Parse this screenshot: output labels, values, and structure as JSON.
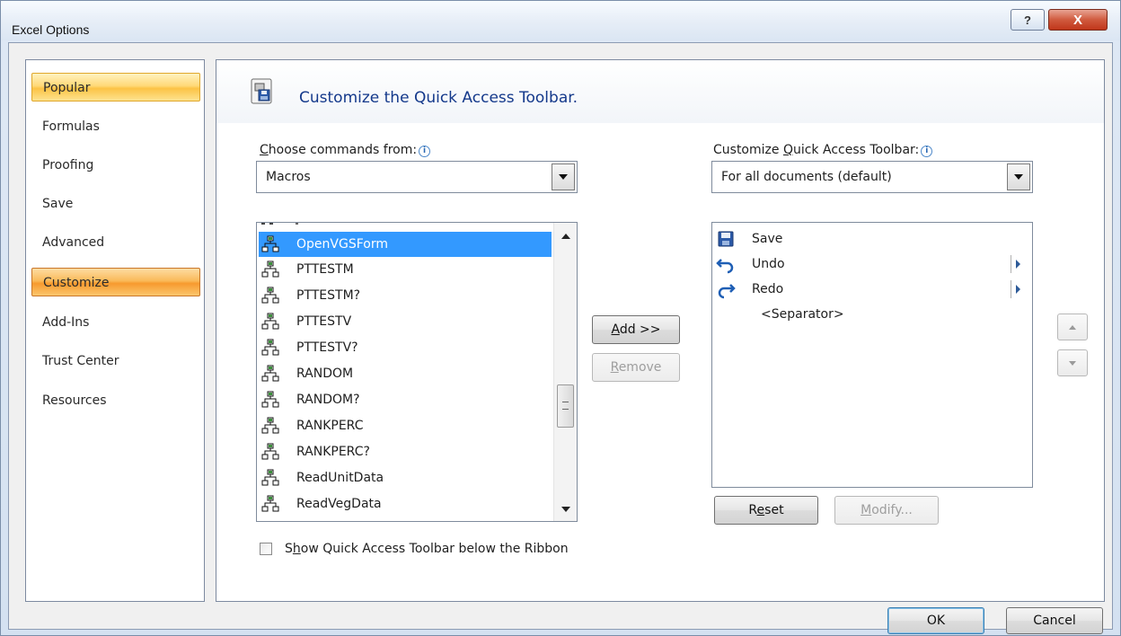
{
  "window": {
    "title": "Excel Options",
    "help_glyph": "?",
    "close_glyph": "X"
  },
  "nav": {
    "items": [
      {
        "label": "Popular",
        "state": "selected"
      },
      {
        "label": "Formulas"
      },
      {
        "label": "Proofing"
      },
      {
        "label": "Save"
      },
      {
        "label": "Advanced"
      },
      {
        "label": "Customize",
        "state": "active"
      },
      {
        "label": "Add-Ins"
      },
      {
        "label": "Trust Center"
      },
      {
        "label": "Resources"
      }
    ]
  },
  "header": {
    "title": "Customize the Quick Access Toolbar.",
    "icon": "customize-toolbar-icon"
  },
  "choose": {
    "label_pre": "",
    "label_key": "C",
    "label_post": "hoose commands from:",
    "value": "Macros"
  },
  "commands": {
    "items": [
      {
        "label": "OpenVGSForm",
        "selected": true
      },
      {
        "label": "PTTESTM"
      },
      {
        "label": "PTTESTM?"
      },
      {
        "label": "PTTESTV"
      },
      {
        "label": "PTTESTV?"
      },
      {
        "label": "RANDOM"
      },
      {
        "label": "RANDOM?"
      },
      {
        "label": "RANKPERC"
      },
      {
        "label": "RANKPERC?"
      },
      {
        "label": "ReadUnitData"
      },
      {
        "label": "ReadVegData"
      }
    ],
    "icon": "macro-icon"
  },
  "actions": {
    "add_key": "A",
    "add_rest": "dd >>",
    "remove_key": "R",
    "remove_rest": "emove"
  },
  "customize": {
    "label_pre": "Customize ",
    "label_key": "Q",
    "label_post": "uick Access Toolbar:",
    "value": "For all documents (default)"
  },
  "toolbar_items": {
    "items": [
      {
        "label": "Save",
        "icon": "save-icon"
      },
      {
        "label": "Undo",
        "icon": "undo-icon",
        "has_dropdown": true
      },
      {
        "label": "Redo",
        "icon": "redo-icon",
        "has_dropdown": true
      },
      {
        "label": "<Separator>"
      }
    ]
  },
  "bottom_actions": {
    "reset_pre": "R",
    "reset_key": "e",
    "reset_post": "set",
    "modify_key": "M",
    "modify_rest": "odify..."
  },
  "show_below": {
    "pre": "S",
    "key": "h",
    "post": "ow Quick Access Toolbar below the Ribbon",
    "checked": false
  },
  "footer": {
    "ok_label": "OK",
    "cancel_label": "Cancel"
  }
}
